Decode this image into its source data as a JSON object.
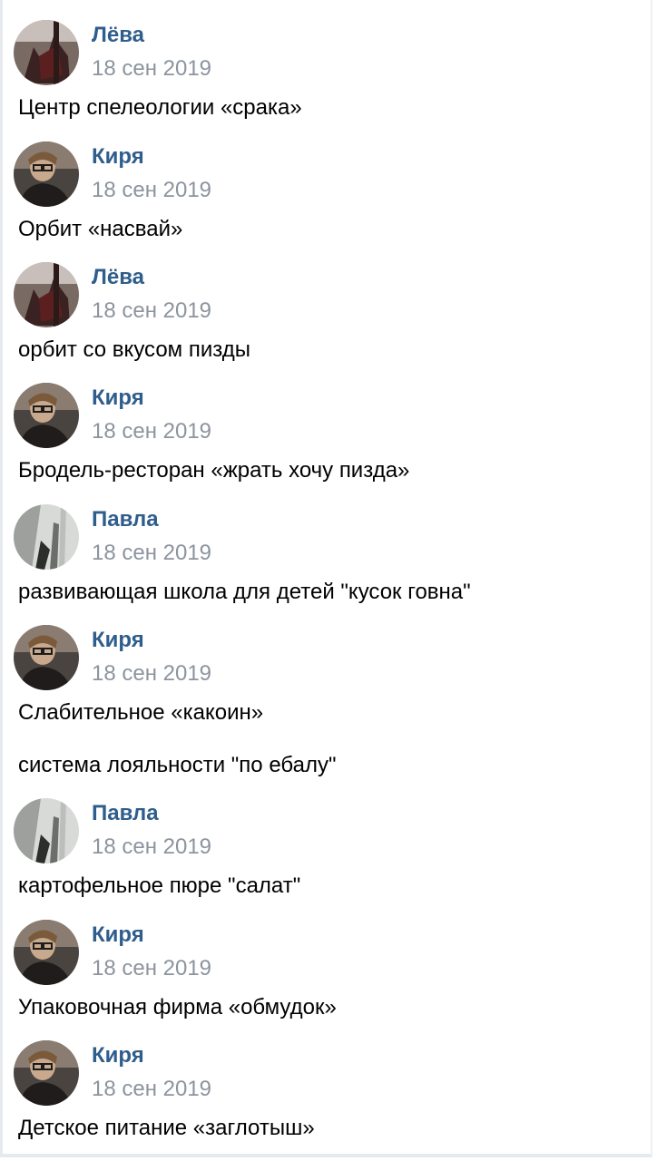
{
  "messages": [
    {
      "author": "Лёва",
      "avatar": "leva-avatar-icon",
      "date": "18 сен 2019",
      "texts": [
        "Центр спелеологии «срака»"
      ]
    },
    {
      "author": "Киря",
      "avatar": "kirya-avatar-icon",
      "date": "18 сен 2019",
      "texts": [
        "Орбит «насвай»"
      ]
    },
    {
      "author": "Лёва",
      "avatar": "leva-avatar-icon",
      "date": "18 сен 2019",
      "texts": [
        "орбит со вкусом пизды"
      ]
    },
    {
      "author": "Киря",
      "avatar": "kirya-avatar-icon",
      "date": "18 сен 2019",
      "texts": [
        "Бродель-ресторан «жрать хочу пизда»"
      ]
    },
    {
      "author": "Павла",
      "avatar": "pavla-avatar-icon",
      "date": "18 сен 2019",
      "texts": [
        "развивающая школа для детей \"кусок говна\""
      ]
    },
    {
      "author": "Киря",
      "avatar": "kirya-avatar-icon",
      "date": "18 сен 2019",
      "texts": [
        "Слабительное «какоин»",
        "система лояльности \"по ебалу\""
      ]
    },
    {
      "author": "Павла",
      "avatar": "pavla-avatar-icon",
      "date": "18 сен 2019",
      "texts": [
        "картофельное пюре \"салат\""
      ]
    },
    {
      "author": "Киря",
      "avatar": "kirya-avatar-icon",
      "date": "18 сен 2019",
      "texts": [
        "Упаковочная фирма «обмудок»"
      ]
    },
    {
      "author": "Киря",
      "avatar": "kirya-avatar-icon",
      "date": "18 сен 2019",
      "texts": [
        "Детское питание «заглотыш»"
      ]
    }
  ],
  "colors": {
    "author_name": "#2f5d8c",
    "date": "#8c949e",
    "text": "#000000",
    "background": "#ffffff"
  }
}
